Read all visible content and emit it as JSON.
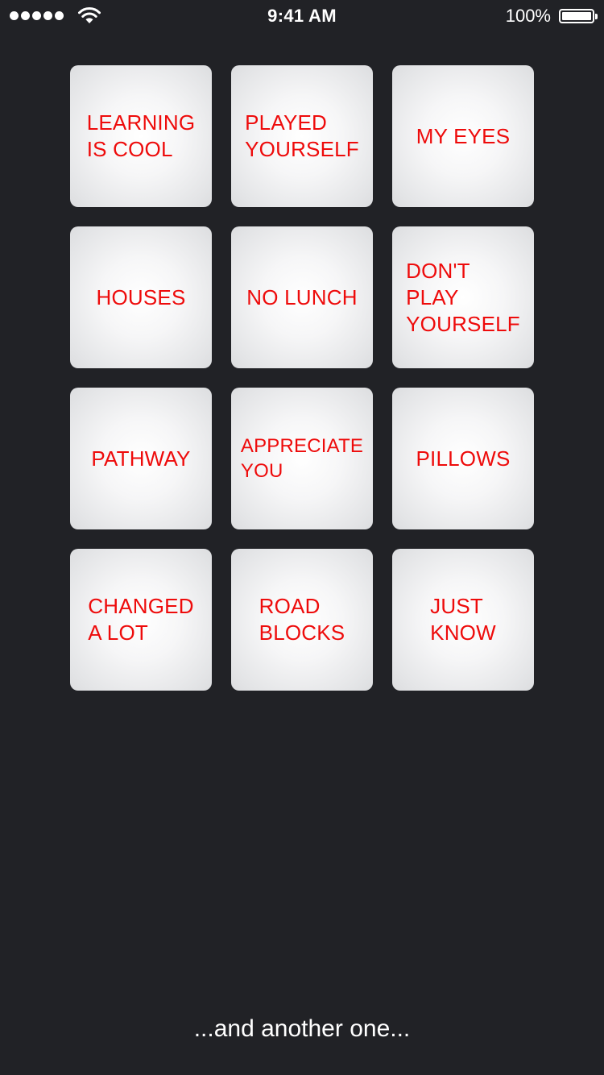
{
  "status_bar": {
    "time": "9:41 AM",
    "battery_percent": "100%",
    "signal_bars": 5
  },
  "tiles": [
    {
      "label": "LEARNING\nIS COOL"
    },
    {
      "label": "PLAYED\nYOURSELF"
    },
    {
      "label": "MY EYES"
    },
    {
      "label": "HOUSES"
    },
    {
      "label": "NO LUNCH"
    },
    {
      "label": "DON'T\nPLAY\nYOURSELF"
    },
    {
      "label": "PATHWAY"
    },
    {
      "label": "APPRECIATE\nYOU"
    },
    {
      "label": "PILLOWS"
    },
    {
      "label": "CHANGED\nA LOT"
    },
    {
      "label": "ROAD\nBLOCKS"
    },
    {
      "label": "JUST\nKNOW"
    }
  ],
  "footer": {
    "text": "...and another one..."
  },
  "colors": {
    "background": "#212226",
    "tile_text": "#ee0b0b",
    "tile_face": "#f2f2f3"
  }
}
